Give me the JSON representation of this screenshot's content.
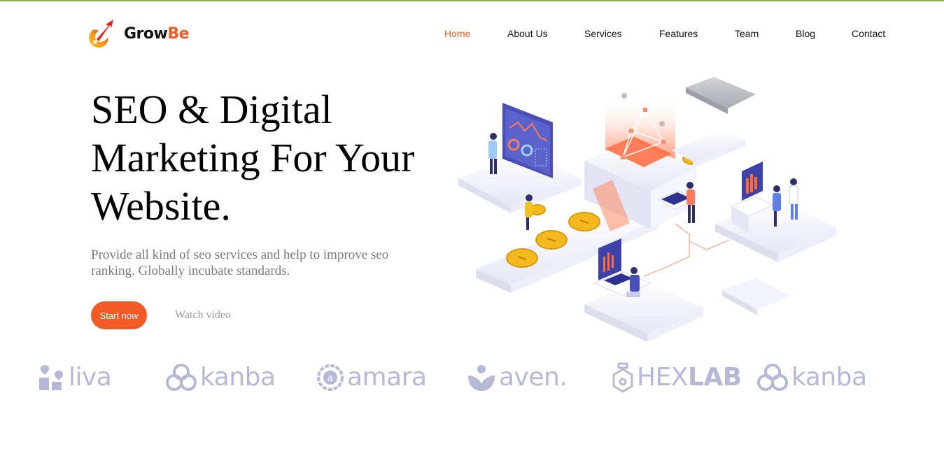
{
  "colors": {
    "accent": "#f15a24",
    "brand_logo_gray": "#b7b8d6",
    "top_border": "#8bb04a"
  },
  "header": {
    "logo_prefix": "Grow",
    "logo_suffix": "Be",
    "nav": [
      {
        "label": "Home",
        "active": true
      },
      {
        "label": "About Us"
      },
      {
        "label": "Services"
      },
      {
        "label": "Features"
      },
      {
        "label": "Team"
      },
      {
        "label": "Blog"
      },
      {
        "label": "Contact"
      }
    ]
  },
  "hero": {
    "title": "SEO & Digital Marketing For Your Website.",
    "subtitle": "Provide all kind of seo services and help to improve seo ranking. Globally incubate standards.",
    "primary_button": "Start now",
    "secondary_link": "Watch video",
    "illustration_icon": "isometric-seo-illustration"
  },
  "brands": [
    {
      "name": "liva",
      "icon": "liva-logo-icon"
    },
    {
      "name": "kanba",
      "icon": "kanba-logo-icon"
    },
    {
      "name": "amara",
      "icon": "amara-logo-icon"
    },
    {
      "name": "aven.",
      "icon": "aven-logo-icon"
    },
    {
      "name_part1": "HEX",
      "name_part2": "LAB",
      "icon": "hexlab-logo-icon"
    },
    {
      "name": "kanba",
      "icon": "kanba-logo-icon"
    }
  ]
}
